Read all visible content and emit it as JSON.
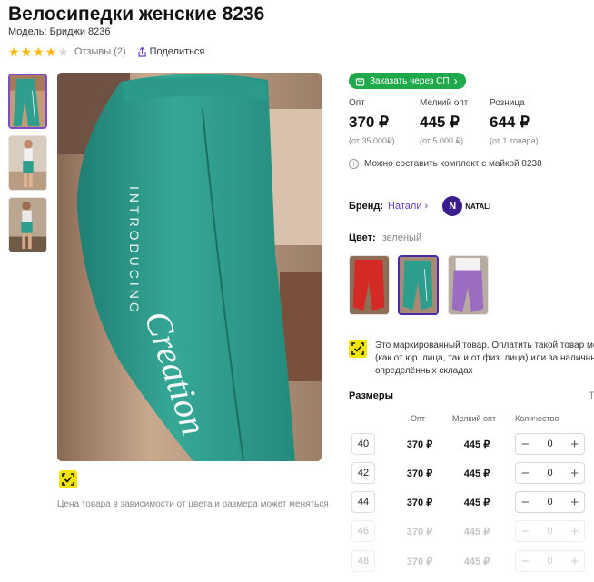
{
  "product": {
    "title": "Велосипедки женские 8236",
    "model": "Модель: Бриджи 8236",
    "rating": 4,
    "rating_max": 5,
    "reviews_label": "Отзывы (2)",
    "share_label": "Поделиться"
  },
  "gallery": {
    "thumbnail_count": 3,
    "active_index": 0,
    "main_image_text": [
      "INTRODUCING",
      "Creation"
    ],
    "price_note": "Цена товара в зависимости от цвета и размера может меняться"
  },
  "order": {
    "button_label": "Заказать через СП"
  },
  "prices": [
    {
      "label": "Опт",
      "value": "370 ₽",
      "note": "(от 35 000₽)"
    },
    {
      "label": "Мелкий опт",
      "value": "445 ₽",
      "note": "(от 5 000 ₽)"
    },
    {
      "label": "Розница",
      "value": "644 ₽",
      "note": "(от 1 товара)"
    }
  ],
  "kit_note": "Можно составить комплект с майкой 8238",
  "brand": {
    "label": "Бренд:",
    "name": "Натали",
    "logo_letter": "N",
    "logo_text": "NATALI"
  },
  "color": {
    "label": "Цвет:",
    "value": "зеленый",
    "swatches": [
      "#d42a26",
      "#2e9e8c",
      "#9a6cc2"
    ],
    "active_index": 1
  },
  "marking_note": {
    "lines": [
      "Это маркированный товар. Оплатить такой товар можно",
      "(как от юр. лица, так и от физ. лица) или за наличный расчёт",
      "определённых складах"
    ]
  },
  "sizes": {
    "title": "Размеры",
    "extra": "Т",
    "headers": {
      "opt": "Опт",
      "small_opt": "Мелкий опт",
      "quantity": "Количество"
    },
    "rows": [
      {
        "size": "40",
        "opt": "370 ₽",
        "small_opt": "445 ₽",
        "qty": "0",
        "available": true
      },
      {
        "size": "42",
        "opt": "370 ₽",
        "small_opt": "445 ₽",
        "qty": "0",
        "available": true
      },
      {
        "size": "44",
        "opt": "370 ₽",
        "small_opt": "445 ₽",
        "qty": "0",
        "available": true
      },
      {
        "size": "46",
        "opt": "370 ₽",
        "small_opt": "445 ₽",
        "qty": "0",
        "available": false
      },
      {
        "size": "48",
        "opt": "370 ₽",
        "small_opt": "445 ₽",
        "qty": "0",
        "available": false
      }
    ],
    "minus": "−",
    "plus": "+"
  },
  "colors": {
    "accent": "#1ea94a",
    "brand_link": "#6b3fc0",
    "star": "#ffb400",
    "marking_badge": "#f2e601"
  }
}
